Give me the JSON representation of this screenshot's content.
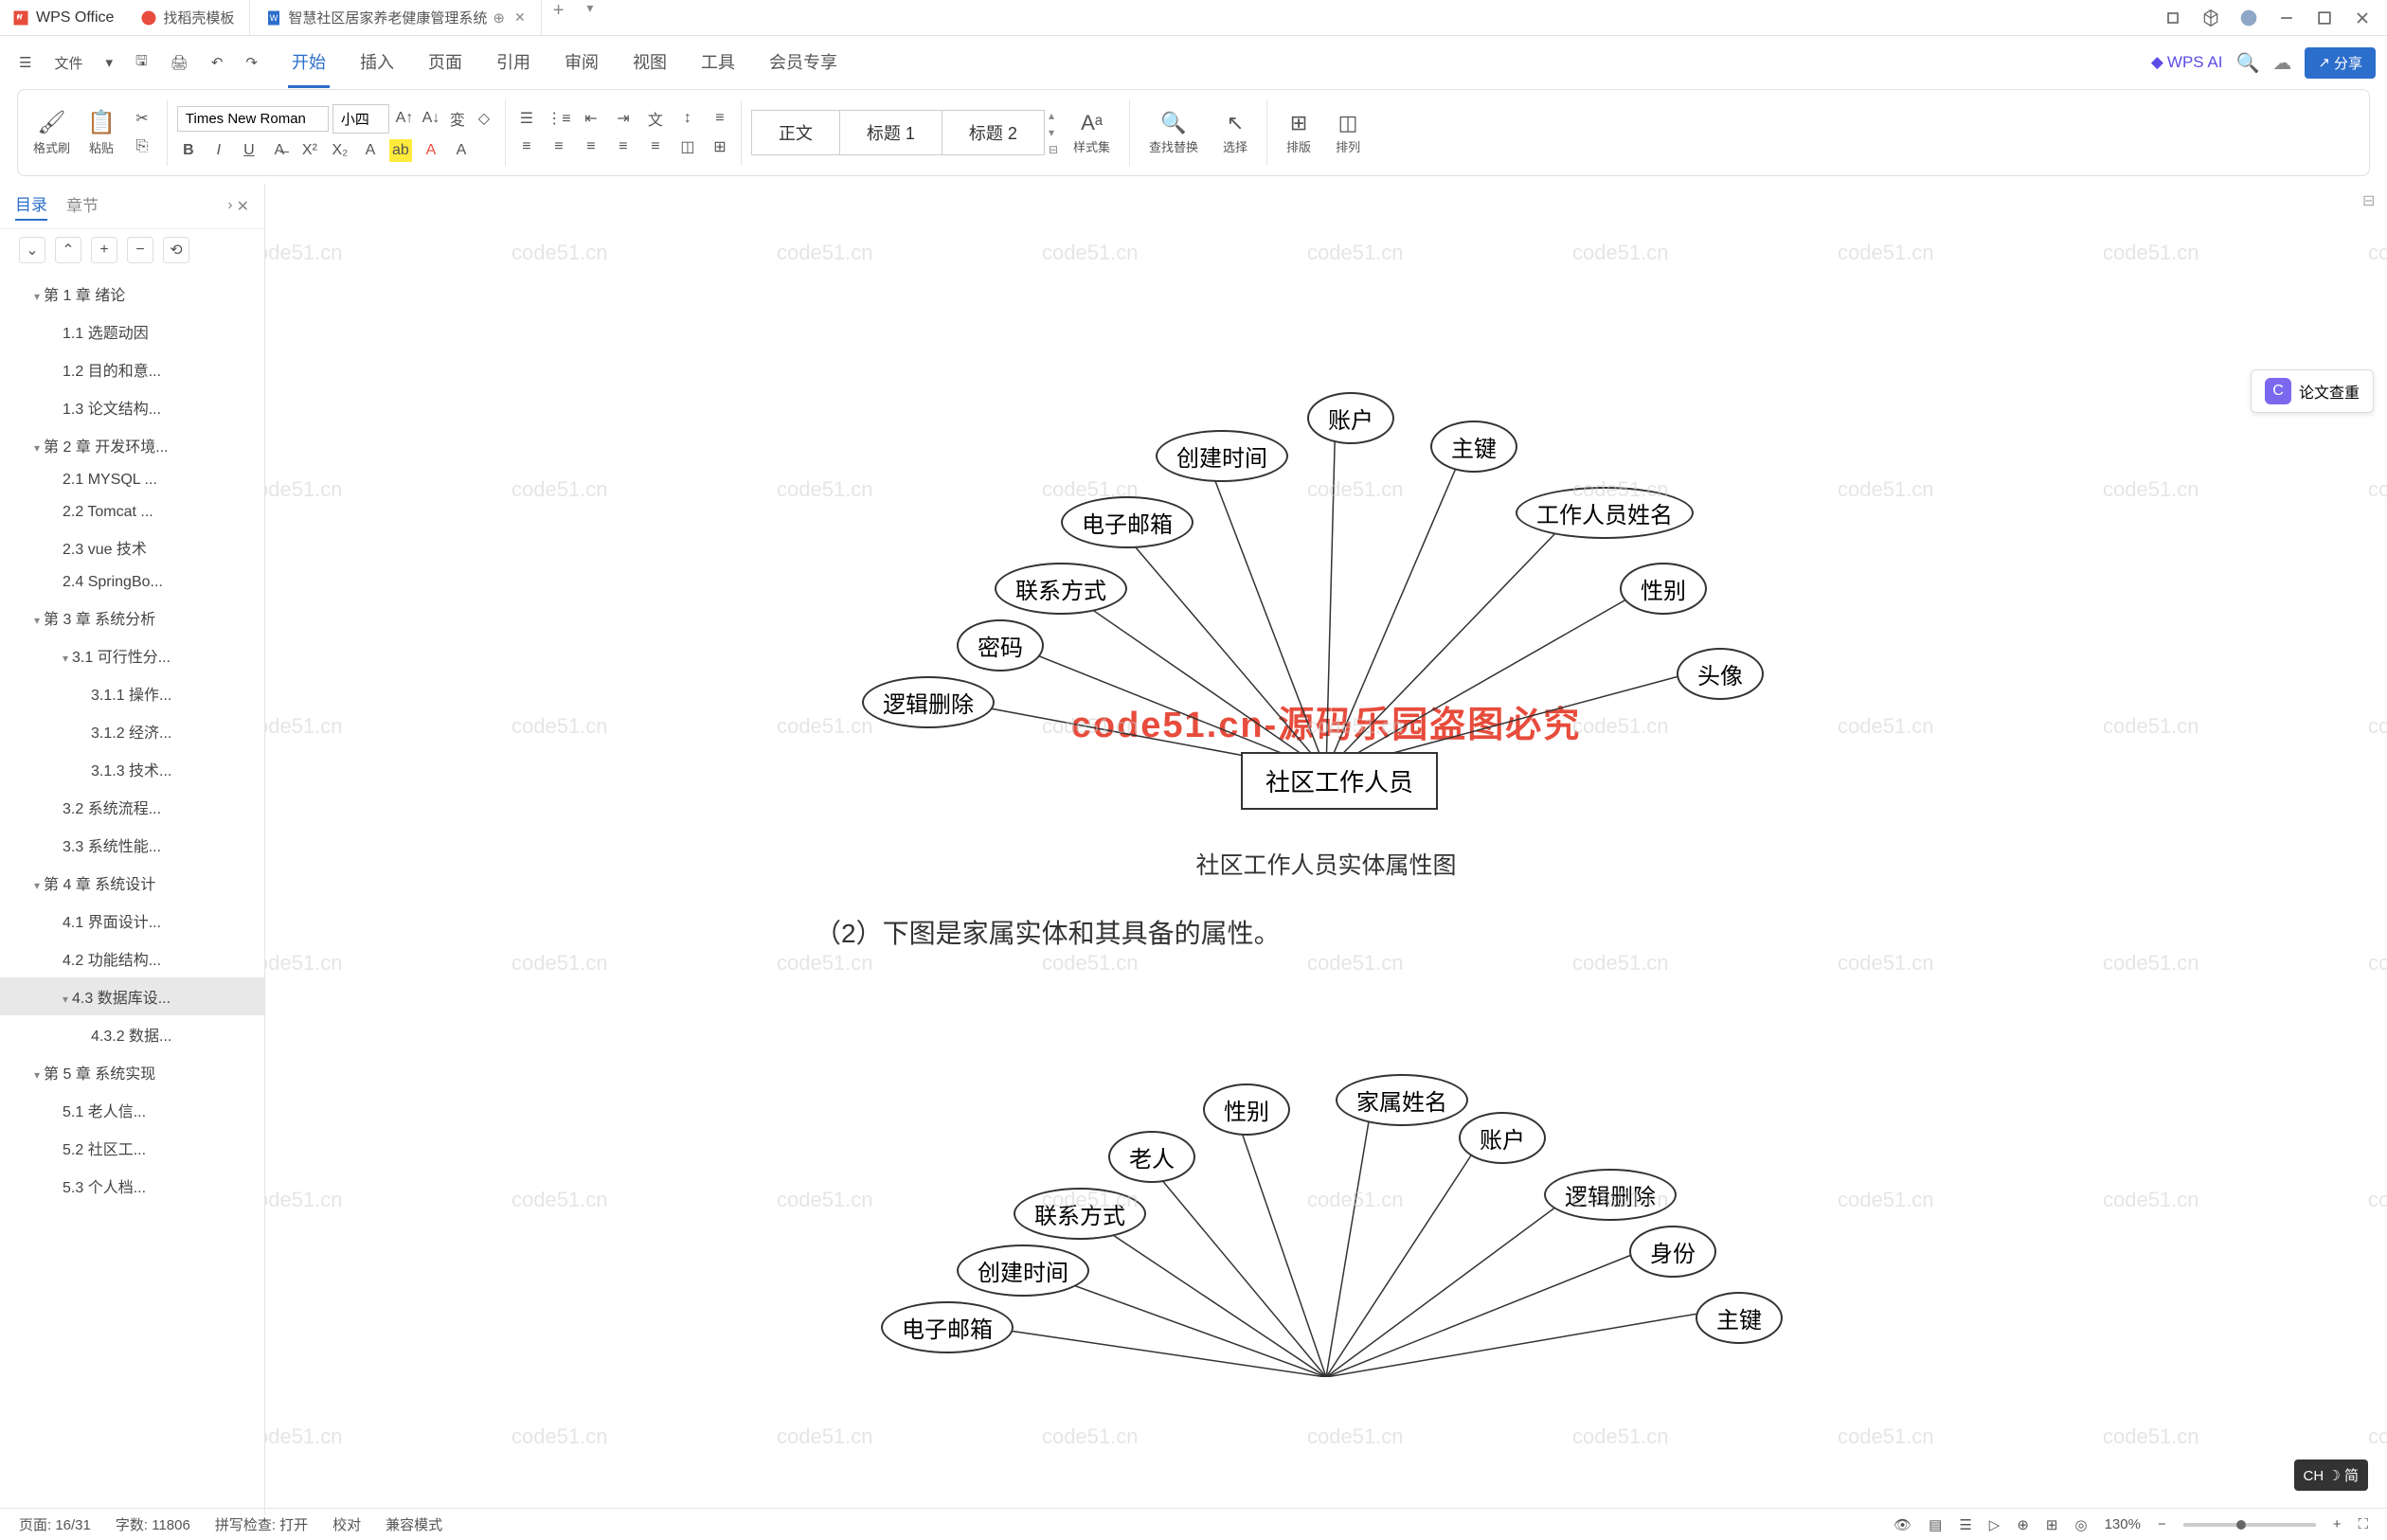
{
  "app": {
    "name": "WPS Office"
  },
  "tabs": [
    {
      "label": "找稻壳模板",
      "iconColor": "#e74c3c"
    },
    {
      "label": "智慧社区居家养老健康管理系统",
      "iconColor": "#2c6ecb",
      "active": true
    }
  ],
  "menu": {
    "file": "文件",
    "items": [
      "开始",
      "插入",
      "页面",
      "引用",
      "审阅",
      "视图",
      "工具",
      "会员专享"
    ],
    "active": "开始",
    "ai": "WPS AI",
    "share": "分享"
  },
  "ribbon": {
    "formatBrush": "格式刷",
    "paste": "粘贴",
    "font": "Times New Roman",
    "fontSize": "小四",
    "styles": {
      "body": "正文",
      "h1": "标题 1",
      "h2": "标题 2"
    },
    "styleSet": "样式集",
    "findReplace": "查找替换",
    "select": "选择",
    "arrange": "排版",
    "order": "排列"
  },
  "sidebar": {
    "tabs": {
      "toc": "目录",
      "chapter": "章节"
    },
    "items": [
      {
        "lvl": 1,
        "txt": "第 1 章  绪论",
        "caret": true
      },
      {
        "lvl": 2,
        "txt": "1.1 选题动因"
      },
      {
        "lvl": 2,
        "txt": "1.2 目的和意..."
      },
      {
        "lvl": 2,
        "txt": "1.3 论文结构..."
      },
      {
        "lvl": 1,
        "txt": "第 2 章  开发环境...",
        "caret": true
      },
      {
        "lvl": 2,
        "txt": "2.1 MYSQL ..."
      },
      {
        "lvl": 2,
        "txt": "2.2 Tomcat ..."
      },
      {
        "lvl": 2,
        "txt": "2.3 vue 技术"
      },
      {
        "lvl": 2,
        "txt": "2.4 SpringBo..."
      },
      {
        "lvl": 1,
        "txt": "第 3 章  系统分析",
        "caret": true
      },
      {
        "lvl": 2,
        "txt": "3.1 可行性分...",
        "caret": true
      },
      {
        "lvl": 3,
        "txt": "3.1.1 操作..."
      },
      {
        "lvl": 3,
        "txt": "3.1.2 经济..."
      },
      {
        "lvl": 3,
        "txt": "3.1.3 技术..."
      },
      {
        "lvl": 2,
        "txt": "3.2 系统流程..."
      },
      {
        "lvl": 2,
        "txt": "3.3 系统性能..."
      },
      {
        "lvl": 1,
        "txt": "第 4 章  系统设计",
        "caret": true
      },
      {
        "lvl": 2,
        "txt": "4.1 界面设计..."
      },
      {
        "lvl": 2,
        "txt": "4.2 功能结构..."
      },
      {
        "lvl": 2,
        "txt": "4.3 数据库设...",
        "caret": true,
        "selected": true
      },
      {
        "lvl": 3,
        "txt": "4.3.2 数据..."
      },
      {
        "lvl": 1,
        "txt": "第 5 章  系统实现",
        "caret": true
      },
      {
        "lvl": 2,
        "txt": "5.1 老人信..."
      },
      {
        "lvl": 2,
        "txt": "5.2 社区工..."
      },
      {
        "lvl": 2,
        "txt": "5.3 个人档..."
      }
    ]
  },
  "doc": {
    "er1": {
      "entity": "社区工作人员",
      "attrs": [
        "逻辑删除",
        "密码",
        "联系方式",
        "电子邮箱",
        "创建时间",
        "账户",
        "主键",
        "工作人员姓名",
        "性别",
        "头像"
      ],
      "caption": "社区工作人员实体属性图"
    },
    "body": "（2）下图是家属实体和其具备的属性。",
    "er2": {
      "attrs": [
        "电子邮箱",
        "创建时间",
        "联系方式",
        "老人",
        "性别",
        "家属姓名",
        "账户",
        "逻辑删除",
        "身份",
        "主键"
      ]
    },
    "watermarkRed": "code51.cn-源码乐园盗图必究",
    "watermark": "code51.cn"
  },
  "paperCheck": "论文查重",
  "status": {
    "page": "页面: 16/31",
    "words": "字数: 11806",
    "spell": "拼写检查: 打开",
    "proof": "校对",
    "compat": "兼容模式",
    "zoom": "130%"
  },
  "ime": "CH ☽ 简"
}
